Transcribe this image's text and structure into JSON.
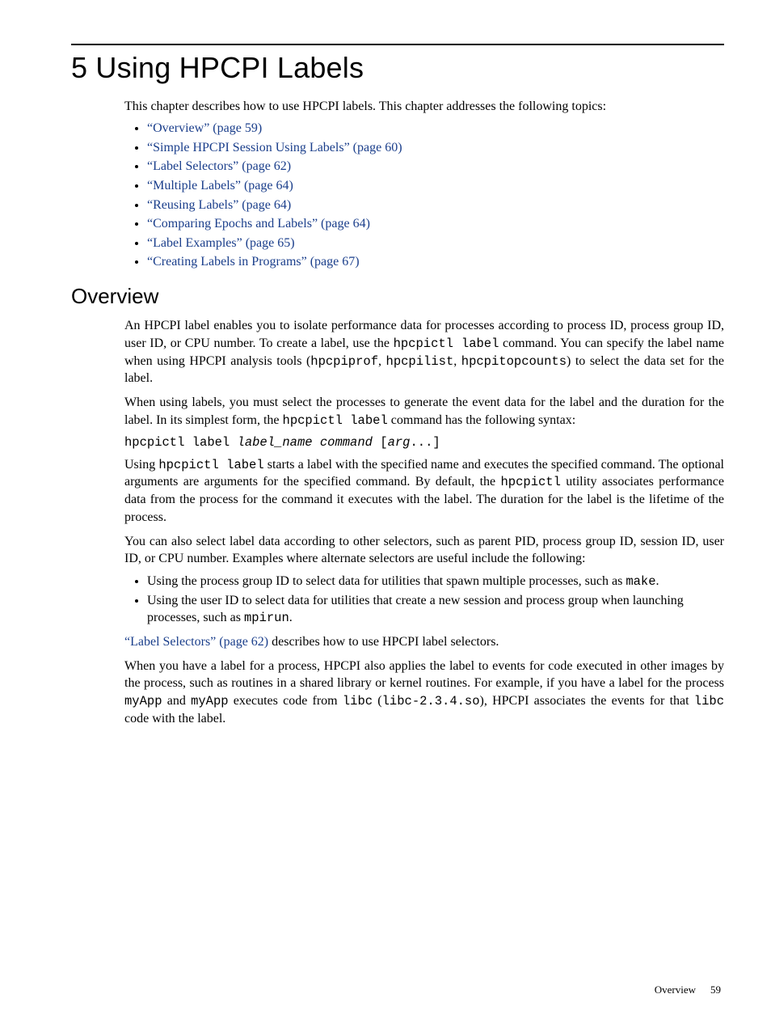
{
  "title": "5 Using HPCPI Labels",
  "intro": "This chapter describes how to use HPCPI labels. This chapter addresses the following topics:",
  "toc": [
    {
      "text": "“Overview” (page 59)"
    },
    {
      "text": "“Simple HPCPI Session Using Labels” (page 60)"
    },
    {
      "text": "“Label Selectors” (page 62)"
    },
    {
      "text": "“Multiple Labels” (page 64)"
    },
    {
      "text": "“Reusing Labels” (page 64)"
    },
    {
      "text": "“Comparing Epochs and Labels” (page 64)"
    },
    {
      "text": "“Label Examples” (page 65)"
    },
    {
      "text": "“Creating Labels in Programs” (page 67)"
    }
  ],
  "section_heading": "Overview",
  "p1": {
    "a": "An HPCPI label enables you to isolate performance data for processes according to process ID, process group ID, user ID, or CPU number. To create a label, use the ",
    "b": "hpcpictl label",
    "c": " command. You can specify the label name when using HPCPI analysis tools (",
    "d": "hpcpiprof",
    "e": ", ",
    "f": "hpcpilist",
    "g": ", ",
    "h": "hpcpitopcounts",
    "i": ") to select the data set for the label."
  },
  "p2": {
    "a": "When using labels, you must select the processes to generate the event data for the label and the duration for the label. In its simplest form, the ",
    "b": "hpcpictl label",
    "c": " command has the following syntax:"
  },
  "cmd": {
    "a": "hpcpictl label ",
    "b": "label_name command",
    "c": " [",
    "d": "arg",
    "e": "...]"
  },
  "p3": {
    "a": "Using ",
    "b": "hpcpictl label",
    "c": " starts a label with the specified name and executes the specified command. The optional arguments are arguments for the specified command. By default, the ",
    "d": "hpcpictl",
    "e": " utility associates performance data from the process for the command it executes with the label. The duration for the label is the lifetime of the process."
  },
  "p4": "You can also select label data according to other selectors, such as parent PID, process group ID, session ID, user ID, or CPU number. Examples where alternate selectors are useful include the following:",
  "bullets2": {
    "b1a": "Using the process group ID to select data for utilities that spawn multiple processes, such as ",
    "b1b": "make",
    "b1c": ".",
    "b2a": "Using the user ID to select data for utilities that create a new session and process group when launching processes, such as ",
    "b2b": "mpirun",
    "b2c": "."
  },
  "p5": {
    "link": "“Label Selectors” (page 62)",
    "rest": " describes how to use HPCPI label selectors."
  },
  "p6": {
    "a": "When you have a label for a process, HPCPI also applies the label to events for code executed in other images by the process, such as routines in a shared library or kernel routines. For example, if you have a label for the process ",
    "b": "myApp",
    "c": " and ",
    "d": "myApp",
    "e": " executes code from ",
    "f": "libc",
    "g": " (",
    "h": "libc-2.3.4.so",
    "i": "), HPCPI associates the events for that ",
    "j": "libc",
    "k": " code with the label."
  },
  "footer": {
    "section": "Overview",
    "page": "59"
  }
}
